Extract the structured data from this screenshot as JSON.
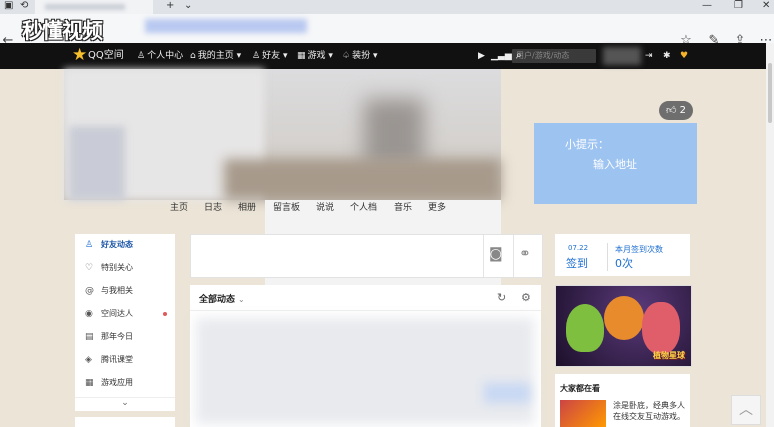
{
  "browser": {
    "address_bar_visible": "",
    "tab_new_symbol": "+",
    "tab_dropdown_symbol": "⌄"
  },
  "watermark": {
    "text": "秒懂视频"
  },
  "qzone_nav": {
    "brand": "QQ空间",
    "items": [
      "个人中心",
      "我的主页",
      "好友",
      "游戏",
      "装扮"
    ],
    "search_placeholder": "用户/游戏/动态"
  },
  "like": {
    "count": "2"
  },
  "tip": {
    "title": "小提示：",
    "text": "输入地址"
  },
  "profile_tabs": [
    "主页",
    "日志",
    "相册",
    "留言板",
    "说说",
    "个人档",
    "音乐",
    "更多"
  ],
  "left_menu": {
    "items": [
      "好友动态",
      "特别关心",
      "与我相关",
      "空间达人",
      "那年今日",
      "腾讯课堂",
      "游戏应用"
    ],
    "expand_symbol": "⌄"
  },
  "feed": {
    "title": "全部动态",
    "arrow": "⌄"
  },
  "sign": {
    "date": "07.22",
    "button": "签到",
    "label": "本月签到次数",
    "count": "0次"
  },
  "banner": {
    "caption": "植物星球"
  },
  "playing": {
    "title": "大家都在看",
    "desc": "涂是卧底，经典多人在线交友互动游戏。"
  },
  "colors": {
    "nav_bg": "#111111",
    "accent": "#1d6fd1",
    "tip_bg": "#9dc3f1",
    "page_bg": "#ebe4d7"
  }
}
